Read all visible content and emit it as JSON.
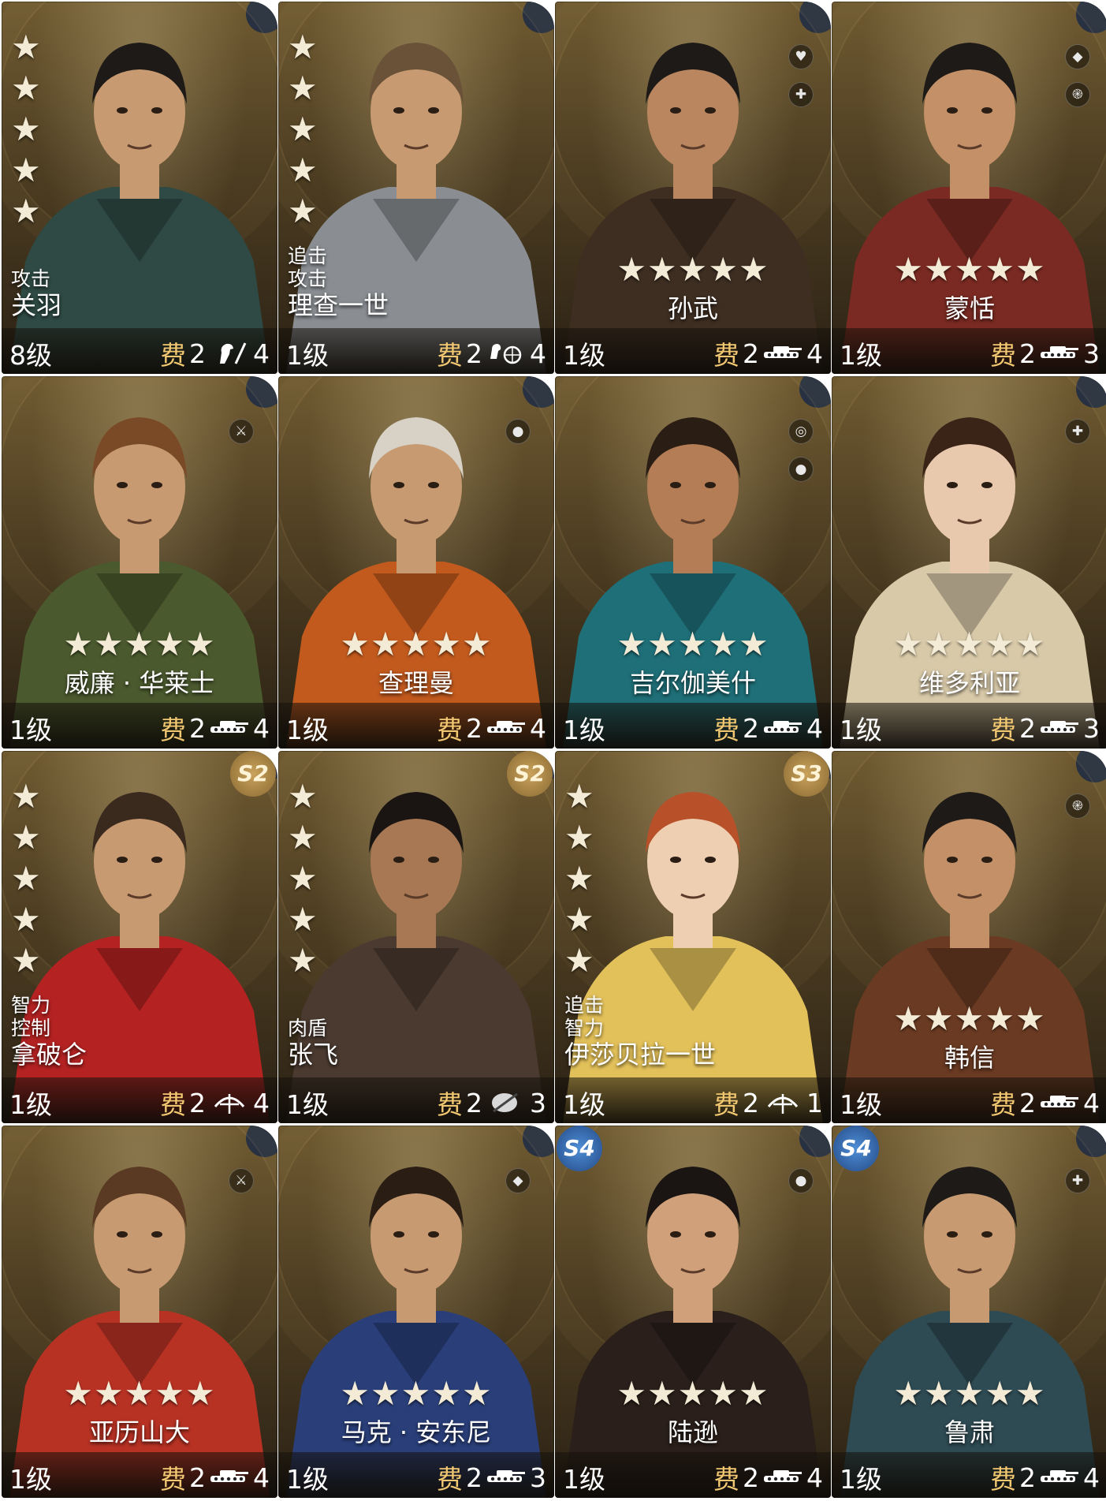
{
  "cards": [
    {
      "name": "关羽",
      "layout": "side",
      "tags": [
        "攻击"
      ],
      "level": "8级",
      "cost_label": "费",
      "cost": "2",
      "unit": "cavalry-icon",
      "unit_count": "4",
      "stars": 5,
      "skill_icons": [],
      "season": "",
      "colors": {
        "cloth": "#2f4a44",
        "skin": "#c89a72",
        "hair": "#1e1a17"
      }
    },
    {
      "name": "理查一世",
      "layout": "side",
      "tags": [
        "追击",
        "攻击"
      ],
      "level": "1级",
      "cost_label": "费",
      "cost": "2",
      "unit": "chariot-icon",
      "unit_count": "4",
      "stars": 5,
      "skill_icons": [],
      "season": "",
      "colors": {
        "cloth": "#8a8e92",
        "skin": "#c89a72",
        "hair": "#6a5238"
      }
    },
    {
      "name": "孙武",
      "layout": "center",
      "tags": [],
      "level": "1级",
      "cost_label": "费",
      "cost": "2",
      "unit": "tank-icon",
      "unit_count": "4",
      "stars": 5,
      "skill_icons": [
        "heal-icon",
        "shield-plus-icon"
      ],
      "season": "",
      "colors": {
        "cloth": "#3e2e22",
        "skin": "#b98660",
        "hair": "#1e1a17"
      }
    },
    {
      "name": "蒙恬",
      "layout": "center",
      "tags": [],
      "level": "1级",
      "cost_label": "费",
      "cost": "2",
      "unit": "tank-icon",
      "unit_count": "3",
      "stars": 5,
      "skill_icons": [
        "shield-icon",
        "spiral-icon"
      ],
      "season": "",
      "colors": {
        "cloth": "#7a2a22",
        "skin": "#c39068",
        "hair": "#1e1a17"
      }
    },
    {
      "name": "威廉 · 华莱士",
      "layout": "center",
      "tags": [],
      "level": "1级",
      "cost_label": "费",
      "cost": "2",
      "unit": "tank-icon",
      "unit_count": "4",
      "stars": 5,
      "skill_icons": [
        "sword-icon"
      ],
      "season": "",
      "colors": {
        "cloth": "#4b5a2e",
        "skin": "#c89a72",
        "hair": "#7a4a26"
      }
    },
    {
      "name": "查理曼",
      "layout": "center",
      "tags": [],
      "level": "1级",
      "cost_label": "费",
      "cost": "2",
      "unit": "tank-icon",
      "unit_count": "4",
      "stars": 5,
      "skill_icons": [
        "fist-icon"
      ],
      "season": "",
      "colors": {
        "cloth": "#c25a1e",
        "skin": "#c89a72",
        "hair": "#d8d2c6"
      }
    },
    {
      "name": "吉尔伽美什",
      "layout": "center",
      "tags": [],
      "level": "1级",
      "cost_label": "费",
      "cost": "2",
      "unit": "tank-icon",
      "unit_count": "4",
      "stars": 5,
      "skill_icons": [
        "target-icon",
        "fist-icon"
      ],
      "season": "",
      "colors": {
        "cloth": "#1f6f78",
        "skin": "#b47d55",
        "hair": "#2a1d14"
      }
    },
    {
      "name": "维多利亚",
      "layout": "center",
      "tags": [],
      "level": "1级",
      "cost_label": "费",
      "cost": "2",
      "unit": "tank-icon",
      "unit_count": "3",
      "stars": 5,
      "skill_icons": [
        "shield-plus-icon"
      ],
      "season": "",
      "colors": {
        "cloth": "#d8c9a8",
        "skin": "#e9c9ae",
        "hair": "#3a2418"
      }
    },
    {
      "name": "拿破仑",
      "layout": "side",
      "tags": [
        "智力",
        "控制"
      ],
      "level": "1级",
      "cost_label": "费",
      "cost": "2",
      "unit": "crossbow-icon",
      "unit_count": "4",
      "stars": 5,
      "skill_icons": [],
      "season": "S2",
      "colors": {
        "cloth": "#b52222",
        "skin": "#c89a72",
        "hair": "#3a2a1e"
      }
    },
    {
      "name": "张飞",
      "layout": "side",
      "tags": [
        "肉盾"
      ],
      "level": "1级",
      "cost_label": "费",
      "cost": "2",
      "unit": "shield-unit-icon",
      "unit_count": "3",
      "stars": 5,
      "skill_icons": [],
      "season": "S2",
      "colors": {
        "cloth": "#4a3a30",
        "skin": "#a87854",
        "hair": "#1a1512"
      }
    },
    {
      "name": "伊莎贝拉一世",
      "layout": "side",
      "tags": [
        "追击",
        "智力"
      ],
      "level": "1级",
      "cost_label": "费",
      "cost": "2",
      "unit": "crossbow-icon",
      "unit_count": "1",
      "stars": 5,
      "skill_icons": [],
      "season": "S3",
      "colors": {
        "cloth": "#e3c15a",
        "skin": "#efcfb2",
        "hair": "#b8502a"
      }
    },
    {
      "name": "韩信",
      "layout": "center",
      "tags": [],
      "level": "1级",
      "cost_label": "费",
      "cost": "2",
      "unit": "tank-icon",
      "unit_count": "4",
      "stars": 5,
      "skill_icons": [
        "spiral-icon"
      ],
      "season": "",
      "colors": {
        "cloth": "#6a3a22",
        "skin": "#c39068",
        "hair": "#1e1a17"
      }
    },
    {
      "name": "亚历山大",
      "layout": "center",
      "tags": [],
      "level": "1级",
      "cost_label": "费",
      "cost": "2",
      "unit": "tank-icon",
      "unit_count": "4",
      "stars": 5,
      "skill_icons": [
        "sword-icon"
      ],
      "season": "",
      "colors": {
        "cloth": "#b83224",
        "skin": "#c89a72",
        "hair": "#5a3a22"
      }
    },
    {
      "name": "马克 · 安东尼",
      "layout": "center",
      "tags": [],
      "level": "1级",
      "cost_label": "费",
      "cost": "2",
      "unit": "tank-icon",
      "unit_count": "3",
      "stars": 5,
      "skill_icons": [
        "shield-icon"
      ],
      "season": "",
      "colors": {
        "cloth": "#2a3f7a",
        "skin": "#c89a72",
        "hair": "#2a1d14"
      }
    },
    {
      "name": "陆逊",
      "layout": "center",
      "tags": [],
      "level": "1级",
      "cost_label": "费",
      "cost": "2",
      "unit": "tank-icon",
      "unit_count": "4",
      "stars": 5,
      "skill_icons": [
        "fist-icon"
      ],
      "season": "S4",
      "colors": {
        "cloth": "#2a1f1a",
        "skin": "#d0a07a",
        "hair": "#1a1512"
      }
    },
    {
      "name": "鲁肃",
      "layout": "center",
      "tags": [],
      "level": "1级",
      "cost_label": "费",
      "cost": "2",
      "unit": "tank-icon",
      "unit_count": "4",
      "stars": 5,
      "skill_icons": [
        "shield-plus-icon"
      ],
      "season": "S4",
      "colors": {
        "cloth": "#2e4a52",
        "skin": "#c89a72",
        "hair": "#1e1a17"
      }
    }
  ]
}
